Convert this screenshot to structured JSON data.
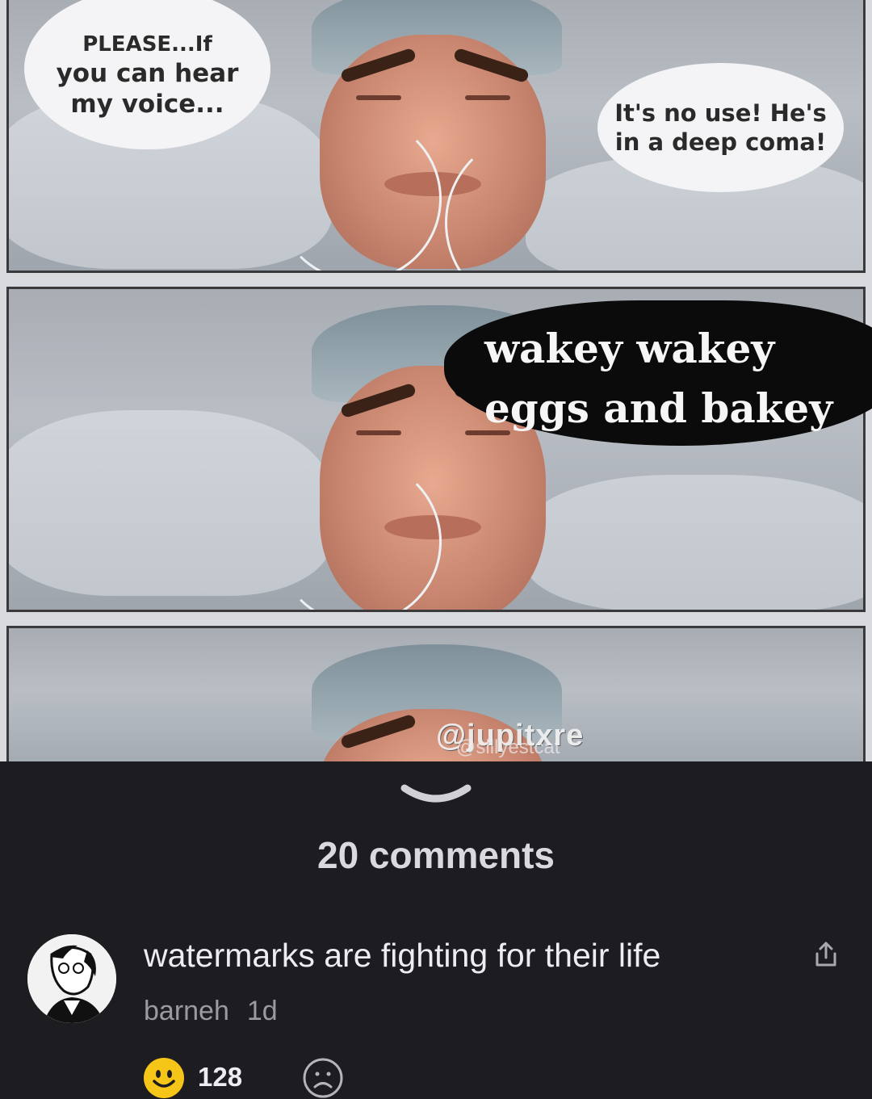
{
  "meme": {
    "panel1_bubble_left_top": "PLEASE...If",
    "panel1_bubble_left": "you can hear\nmy voice...",
    "panel1_bubble_right": "It's no use! He's\nin a deep coma!",
    "panel2_bubble": "wakey wakey\neggs and bakey",
    "watermark": "@jupitxre",
    "watermark_secondary": "@sillyestcat"
  },
  "comments": {
    "count_label": "20 comments",
    "items": [
      {
        "text": "watermarks are fighting for their life",
        "author": "barneh",
        "time": "1d",
        "reaction_count": "128"
      }
    ]
  },
  "colors": {
    "sheet_bg": "#1c1c21",
    "reaction_yellow": "#f5c518"
  }
}
